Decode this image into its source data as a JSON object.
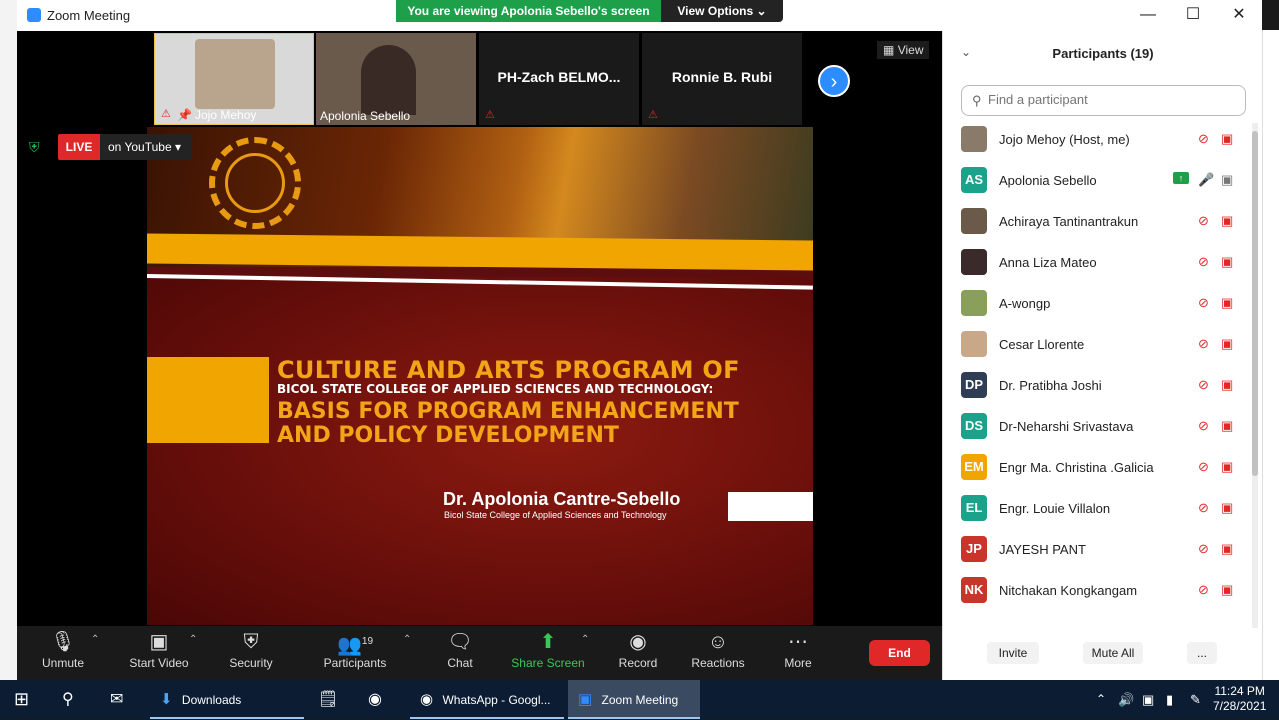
{
  "window": {
    "title": "Zoom Meeting",
    "viewing_banner": "You are viewing Apolonia Sebello's screen",
    "view_options": "View Options"
  },
  "thumbnails": [
    {
      "name": "Jojo Mehoy",
      "type": "video"
    },
    {
      "name": "Apolonia Sebello",
      "type": "video"
    },
    {
      "name": "PH-Zach BELMO...",
      "type": "name"
    },
    {
      "name": "Ronnie B. Rubi",
      "type": "name"
    }
  ],
  "view_button": "View",
  "live": {
    "badge": "LIVE",
    "destination": "on YouTube"
  },
  "slide": {
    "title_line1": "CULTURE AND ARTS PROGRAM OF",
    "title_line2": "BICOL STATE COLLEGE OF APPLIED SCIENCES AND TECHNOLOGY:",
    "title_line3": "BASIS FOR PROGRAM ENHANCEMENT",
    "title_line4": "AND POLICY DEVELOPMENT",
    "author": "Dr. Apolonia Cantre-Sebello",
    "affiliation": "Bicol State College of Applied Sciences and Technology",
    "colors": {
      "maroon": "#6a0f0b",
      "gold": "#f0a500"
    }
  },
  "toolbar": {
    "unmute": "Unmute",
    "start_video": "Start Video",
    "security": "Security",
    "participants": "Participants",
    "participants_count": "19",
    "chat": "Chat",
    "share_screen": "Share Screen",
    "record": "Record",
    "reactions": "Reactions",
    "more": "More",
    "end": "End"
  },
  "panel": {
    "title": "Participants (19)",
    "search_placeholder": "Find a participant",
    "participants": [
      {
        "name": "Jojo Mehoy (Host, me)",
        "initials": "",
        "color": "#8a7a6a",
        "sharing": false
      },
      {
        "name": "Apolonia Sebello",
        "initials": "AS",
        "color": "#1aa38a",
        "sharing": true
      },
      {
        "name": "Achiraya Tantinantrakun",
        "initials": "",
        "color": "#6b5a4a",
        "sharing": false
      },
      {
        "name": "Anna Liza Mateo",
        "initials": "",
        "color": "#3a2a2a",
        "sharing": false
      },
      {
        "name": "A-wongp",
        "initials": "",
        "color": "#8aa05a",
        "sharing": false
      },
      {
        "name": "Cesar Llorente",
        "initials": "",
        "color": "#c9a88a",
        "sharing": false
      },
      {
        "name": "Dr. Pratibha Joshi",
        "initials": "DP",
        "color": "#2f3e55",
        "sharing": false
      },
      {
        "name": "Dr-Neharshi Srivastava",
        "initials": "DS",
        "color": "#1aa38a",
        "sharing": false
      },
      {
        "name": "Engr Ma. Christina .Galicia",
        "initials": "EM",
        "color": "#f0a500",
        "sharing": false
      },
      {
        "name": "Engr. Louie Villalon",
        "initials": "EL",
        "color": "#1aa38a",
        "sharing": false
      },
      {
        "name": "JAYESH PANT",
        "initials": "JP",
        "color": "#c9352a",
        "sharing": false
      },
      {
        "name": "Nitchakan Kongkangam",
        "initials": "NK",
        "color": "#c9352a",
        "sharing": false
      }
    ],
    "invite": "Invite",
    "mute_all": "Mute All",
    "more": "..."
  },
  "taskbar": {
    "downloads": "Downloads",
    "whatsapp": "WhatsApp - Googl...",
    "zoom": "Zoom Meeting",
    "time": "11:24 PM",
    "date": "7/28/2021"
  }
}
